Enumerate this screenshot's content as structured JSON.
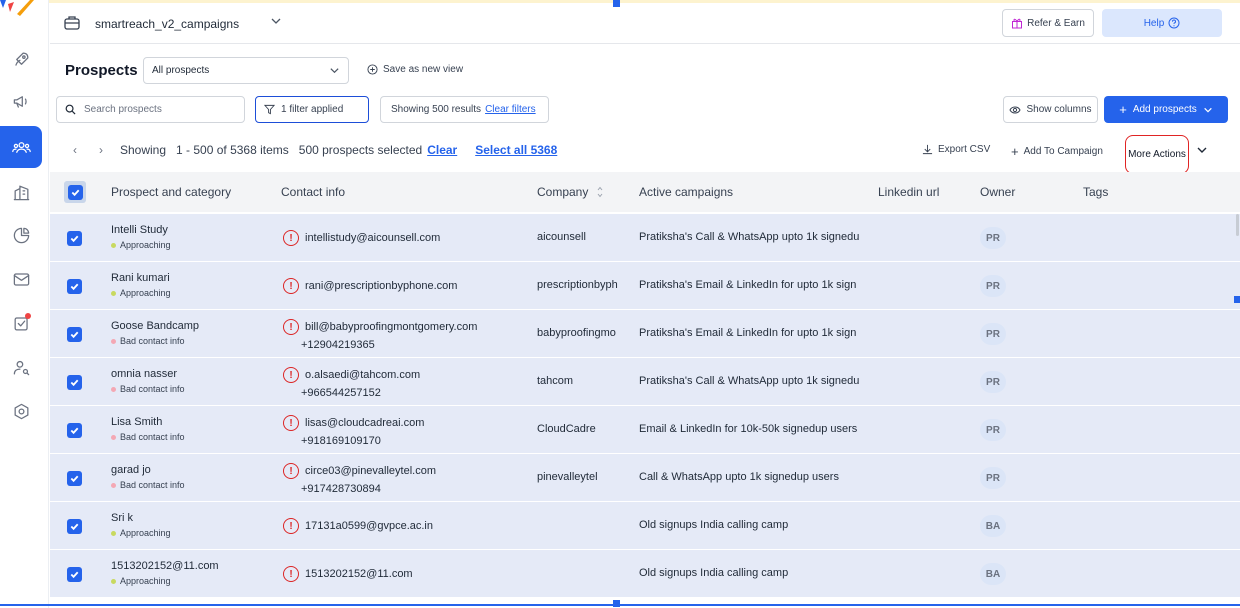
{
  "header": {
    "team_name": "smartreach_v2_campaigns",
    "refer_label": "Refer & Earn",
    "help_label": "Help"
  },
  "toolbar": {
    "title": "Prospects",
    "view_select": "All prospects",
    "save_view": "Save as new view",
    "search_placeholder": "Search prospects",
    "filter_label": "1 filter applied",
    "results_text": "Showing 500 results",
    "clear_filters": "Clear filters",
    "show_columns": "Show columns",
    "add_prospects": "Add prospects"
  },
  "pager": {
    "showing": "Showing",
    "range": "1 - 500 of 5368 items",
    "selected": "500 prospects selected",
    "clear": "Clear",
    "select_all": "Select all 5368",
    "export_csv": "Export CSV",
    "add_to_campaign": "Add To Campaign",
    "more_actions": "More Actions"
  },
  "columns": {
    "prospect": "Prospect and category",
    "contact": "Contact info",
    "company": "Company",
    "campaigns": "Active campaigns",
    "linkedin": "Linkedin url",
    "owner": "Owner",
    "tags": "Tags"
  },
  "colors": {
    "approaching": "#c8d960",
    "bad_contact": "#f4a8b4",
    "accent": "#2563eb"
  },
  "rows": [
    {
      "name": "Intelli Study",
      "category": "Approaching",
      "cat_color": "#c8d960",
      "email": "intellistudy@aicounsell.com",
      "phone": "",
      "company": "aicounsell",
      "campaign": "Pratiksha's Call & WhatsApp upto 1k signedu",
      "owner": "PR"
    },
    {
      "name": "Rani kumari",
      "category": "Approaching",
      "cat_color": "#c8d960",
      "email": "rani@prescriptionbyphone.com",
      "phone": "",
      "company": "prescriptionbyph",
      "campaign": "Pratiksha's Email & LinkedIn for upto 1k sign",
      "owner": "PR"
    },
    {
      "name": "Goose Bandcamp",
      "category": "Bad contact info",
      "cat_color": "#f4a8b4",
      "email": "bill@babyproofingmontgomery.com",
      "phone": "+12904219365",
      "company": "babyproofingmo",
      "campaign": "Pratiksha's Email & LinkedIn for upto 1k sign",
      "owner": "PR"
    },
    {
      "name": "omnia nasser",
      "category": "Bad contact info",
      "cat_color": "#f4a8b4",
      "email": "o.alsaedi@tahcom.com",
      "phone": "+966544257152",
      "company": "tahcom",
      "campaign": "Pratiksha's Call & WhatsApp upto 1k signedu",
      "owner": "PR"
    },
    {
      "name": "Lisa Smith",
      "category": "Bad contact info",
      "cat_color": "#f4a8b4",
      "email": "lisas@cloudcadreai.com",
      "phone": "+918169109170",
      "company": "CloudCadre",
      "campaign": "Email & LinkedIn for 10k-50k signedup users",
      "owner": "PR"
    },
    {
      "name": "garad jo",
      "category": "Bad contact info",
      "cat_color": "#f4a8b4",
      "email": "circe03@pinevalleytel.com",
      "phone": "+917428730894",
      "company": "pinevalleytel",
      "campaign": "Call & WhatsApp upto 1k signedup users",
      "owner": "PR"
    },
    {
      "name": "Sri k",
      "category": "Approaching",
      "cat_color": "#c8d960",
      "email": "17131a0599@gvpce.ac.in",
      "phone": "",
      "company": "",
      "campaign": "Old signups India calling camp",
      "owner": "BA"
    },
    {
      "name": "1513202152@11.com",
      "category": "Approaching",
      "cat_color": "#c8d960",
      "email": "1513202152@11.com",
      "phone": "",
      "company": "",
      "campaign": "Old signups India calling camp",
      "owner": "BA"
    }
  ]
}
